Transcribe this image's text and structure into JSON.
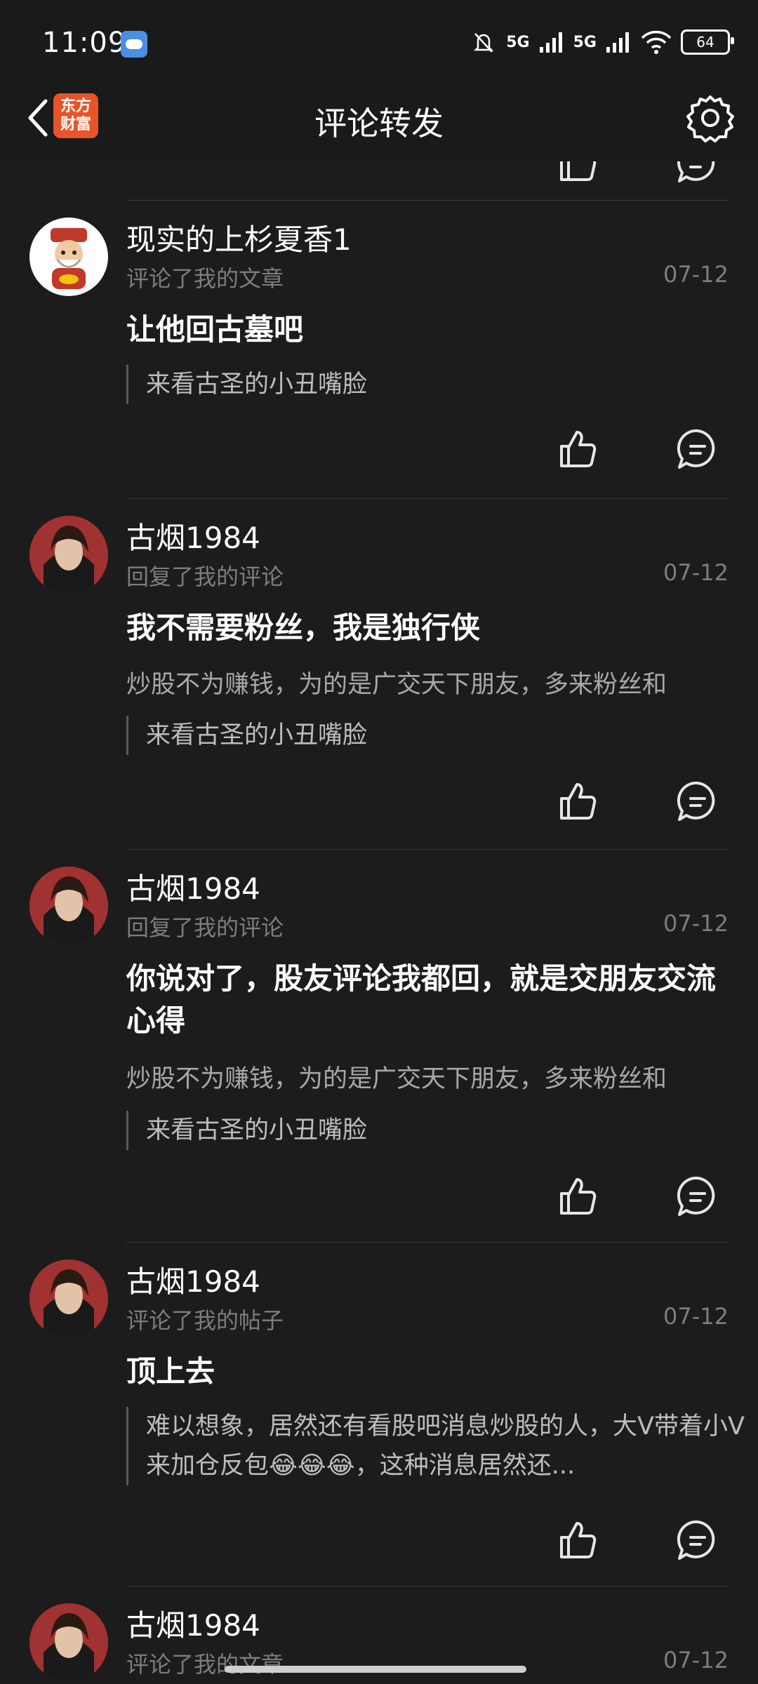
{
  "status": {
    "time": "11:09",
    "net1": "5G",
    "net2": "5G",
    "battery": "64"
  },
  "nav": {
    "title": "评论转发",
    "logo_line1": "东方",
    "logo_line2": "财富"
  },
  "items": [
    {
      "user": "现实的上杉夏香1",
      "action": "评论了我的文章",
      "date": "07-12",
      "comment": "让他回古墓吧",
      "reply": "",
      "quote": "来看古圣的小丑嘴脸"
    },
    {
      "user": "古烟1984",
      "action": "回复了我的评论",
      "date": "07-12",
      "comment": "我不需要粉丝，我是独行侠",
      "reply": "炒股不为赚钱，为的是广交天下朋友，多来粉丝和",
      "quote": "来看古圣的小丑嘴脸"
    },
    {
      "user": "古烟1984",
      "action": "回复了我的评论",
      "date": "07-12",
      "comment": "你说对了，股友评论我都回，就是交朋友交流心得",
      "reply": "炒股不为赚钱，为的是广交天下朋友，多来粉丝和",
      "quote": "来看古圣的小丑嘴脸"
    },
    {
      "user": "古烟1984",
      "action": "评论了我的帖子",
      "date": "07-12",
      "comment": "顶上去",
      "reply": "",
      "quote": "难以想象，居然还有看股吧消息炒股的人，大V带着小V来加仓反包😂😂😂，这种消息居然还..."
    },
    {
      "user": "古烟1984",
      "action": "评论了我的文章",
      "date": "07-12",
      "comment": "",
      "reply": "",
      "quote": ""
    }
  ]
}
